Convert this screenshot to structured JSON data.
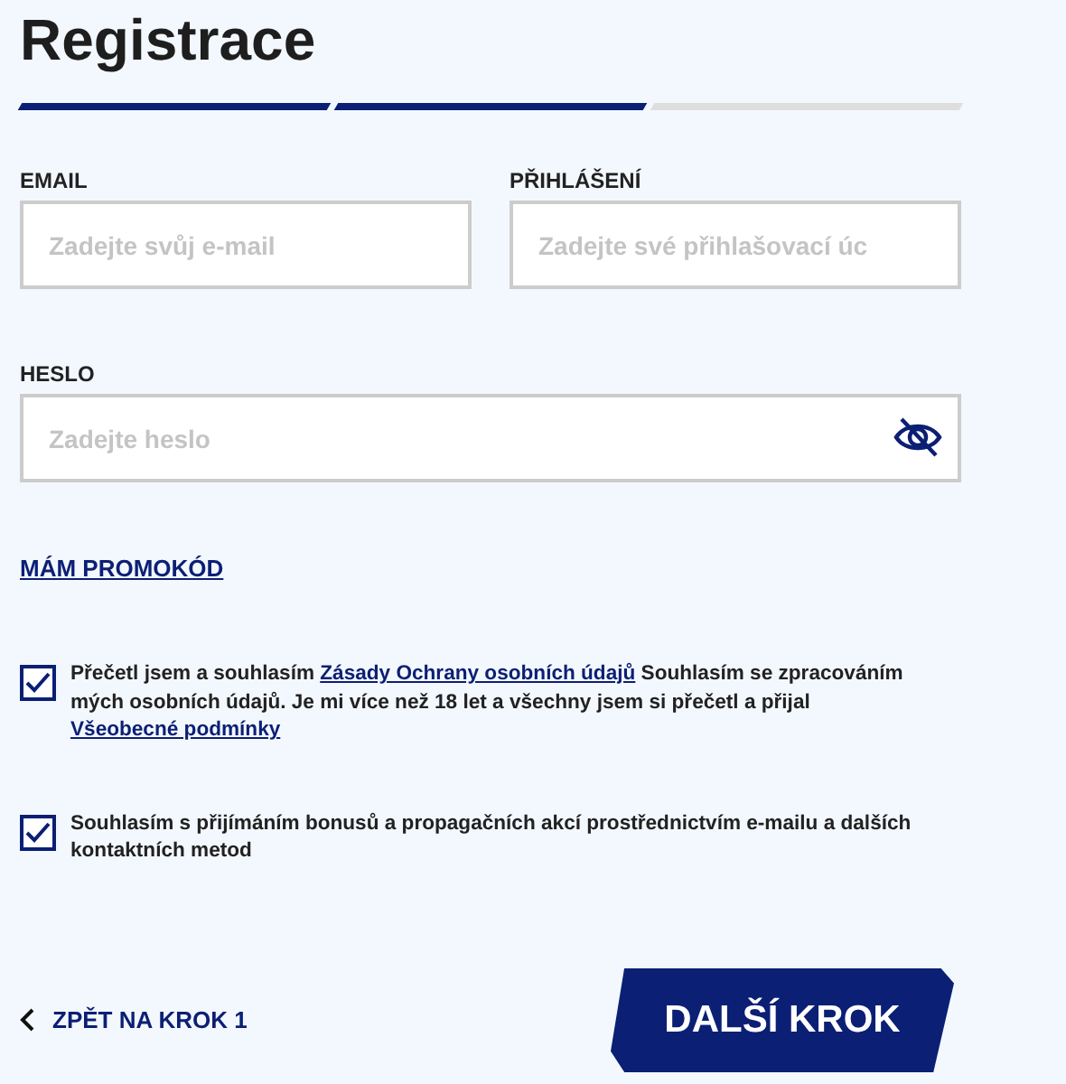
{
  "title": "Registrace",
  "steps": [
    {
      "completed": true
    },
    {
      "completed": true
    },
    {
      "completed": false
    }
  ],
  "fields": [
    {
      "label": "EMAIL",
      "placeholder": "Zadejte svůj e-mail",
      "kind": "text"
    },
    {
      "label": "PŘIHLÁŠENÍ",
      "placeholder": "Zadejte své přihlašovací úc",
      "kind": "text"
    },
    {
      "label": "HESLO",
      "placeholder": "Zadejte heslo",
      "kind": "password"
    }
  ],
  "promo_link": "MÁM PROMOKÓD",
  "consents": [
    {
      "checked": true,
      "parts": [
        {
          "kind": "text",
          "text": "Přečetl jsem a souhlasím "
        },
        {
          "kind": "link",
          "text": "Zásady Ochrany osobních údajů"
        },
        {
          "kind": "text",
          "text": " Souhlasím se zpracováním mých osobních údajů. Je mi více než 18 let a všechny jsem si přečetl a přijal "
        },
        {
          "kind": "link",
          "text": "Všeobecné podmínky"
        }
      ]
    },
    {
      "checked": true,
      "parts": [
        {
          "kind": "text",
          "text": "Souhlasím s přijímáním bonusů a propagačních akcí prostřednictvím e-mailu a dalších kontaktních metod"
        }
      ]
    }
  ],
  "back_link": "ZPĚT NA KROK 1",
  "next_button": "DALŠÍ KROK"
}
